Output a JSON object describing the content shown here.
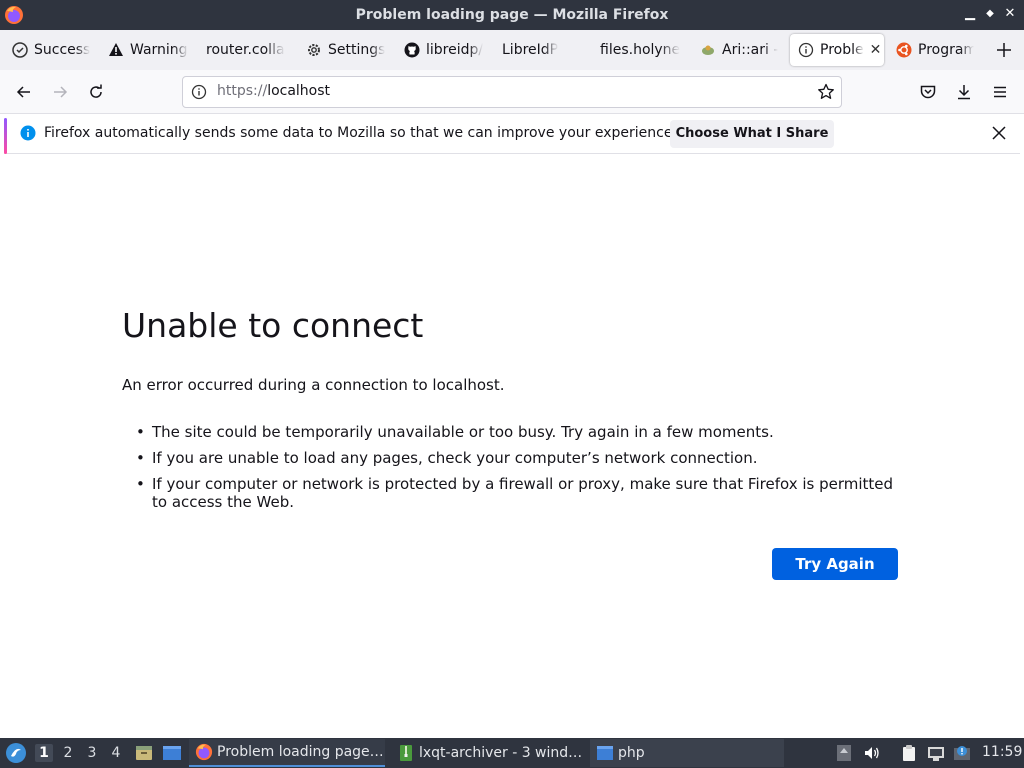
{
  "window": {
    "title": "Problem loading page — Mozilla Firefox",
    "controls": {
      "minimize": "▁",
      "maximize": "◆",
      "close": "✕"
    }
  },
  "tabs": [
    {
      "label": "Success",
      "icon": "check-circle-icon",
      "active": false
    },
    {
      "label": "Warning",
      "icon": "warning-icon",
      "active": false
    },
    {
      "label": "router.colla",
      "icon": "",
      "active": false
    },
    {
      "label": "Settings",
      "icon": "gear-icon",
      "active": false
    },
    {
      "label": "libreidp/",
      "icon": "github-icon",
      "active": false
    },
    {
      "label": "LibreIdP",
      "icon": "",
      "active": false
    },
    {
      "label": "files.holyne",
      "icon": "",
      "active": false
    },
    {
      "label": "Ari::ari -",
      "icon": "ari-icon",
      "active": false
    },
    {
      "label": "Proble",
      "icon": "info-icon",
      "active": true
    },
    {
      "label": "Program",
      "icon": "ubuntu-icon",
      "active": false
    }
  ],
  "navbar": {
    "url_scheme": "https://",
    "url_host": "localhost"
  },
  "notification": {
    "message": "Firefox automatically sends some data to Mozilla so that we can improve your experience.",
    "button_label": "Choose What I Share"
  },
  "error_page": {
    "title": "Unable to connect",
    "description": "An error occurred during a connection to localhost.",
    "bullets": [
      "The site could be temporarily unavailable or too busy. Try again in a few moments.",
      "If you are unable to load any pages, check your computer’s network connection.",
      "If your computer or network is protected by a firewall or proxy, make sure that Firefox is permitted to access the Web."
    ],
    "button_label": "Try Again",
    "button_color": "#0061e0"
  },
  "taskbar": {
    "desktops": [
      "1",
      "2",
      "3",
      "4"
    ],
    "active_desktop": "1",
    "tasks": [
      {
        "label": "Problem loading page…",
        "icon": "firefox-icon"
      },
      {
        "label": "lxqt-archiver - 3 wind…",
        "icon": "archive-icon"
      },
      {
        "label": "php",
        "icon": "terminal-icon"
      }
    ],
    "clock": "11:59"
  },
  "colors": {
    "titlebar_bg": "#2f343f",
    "tabstrip_bg": "#f0f0f4",
    "accent_blue": "#0061e0"
  }
}
